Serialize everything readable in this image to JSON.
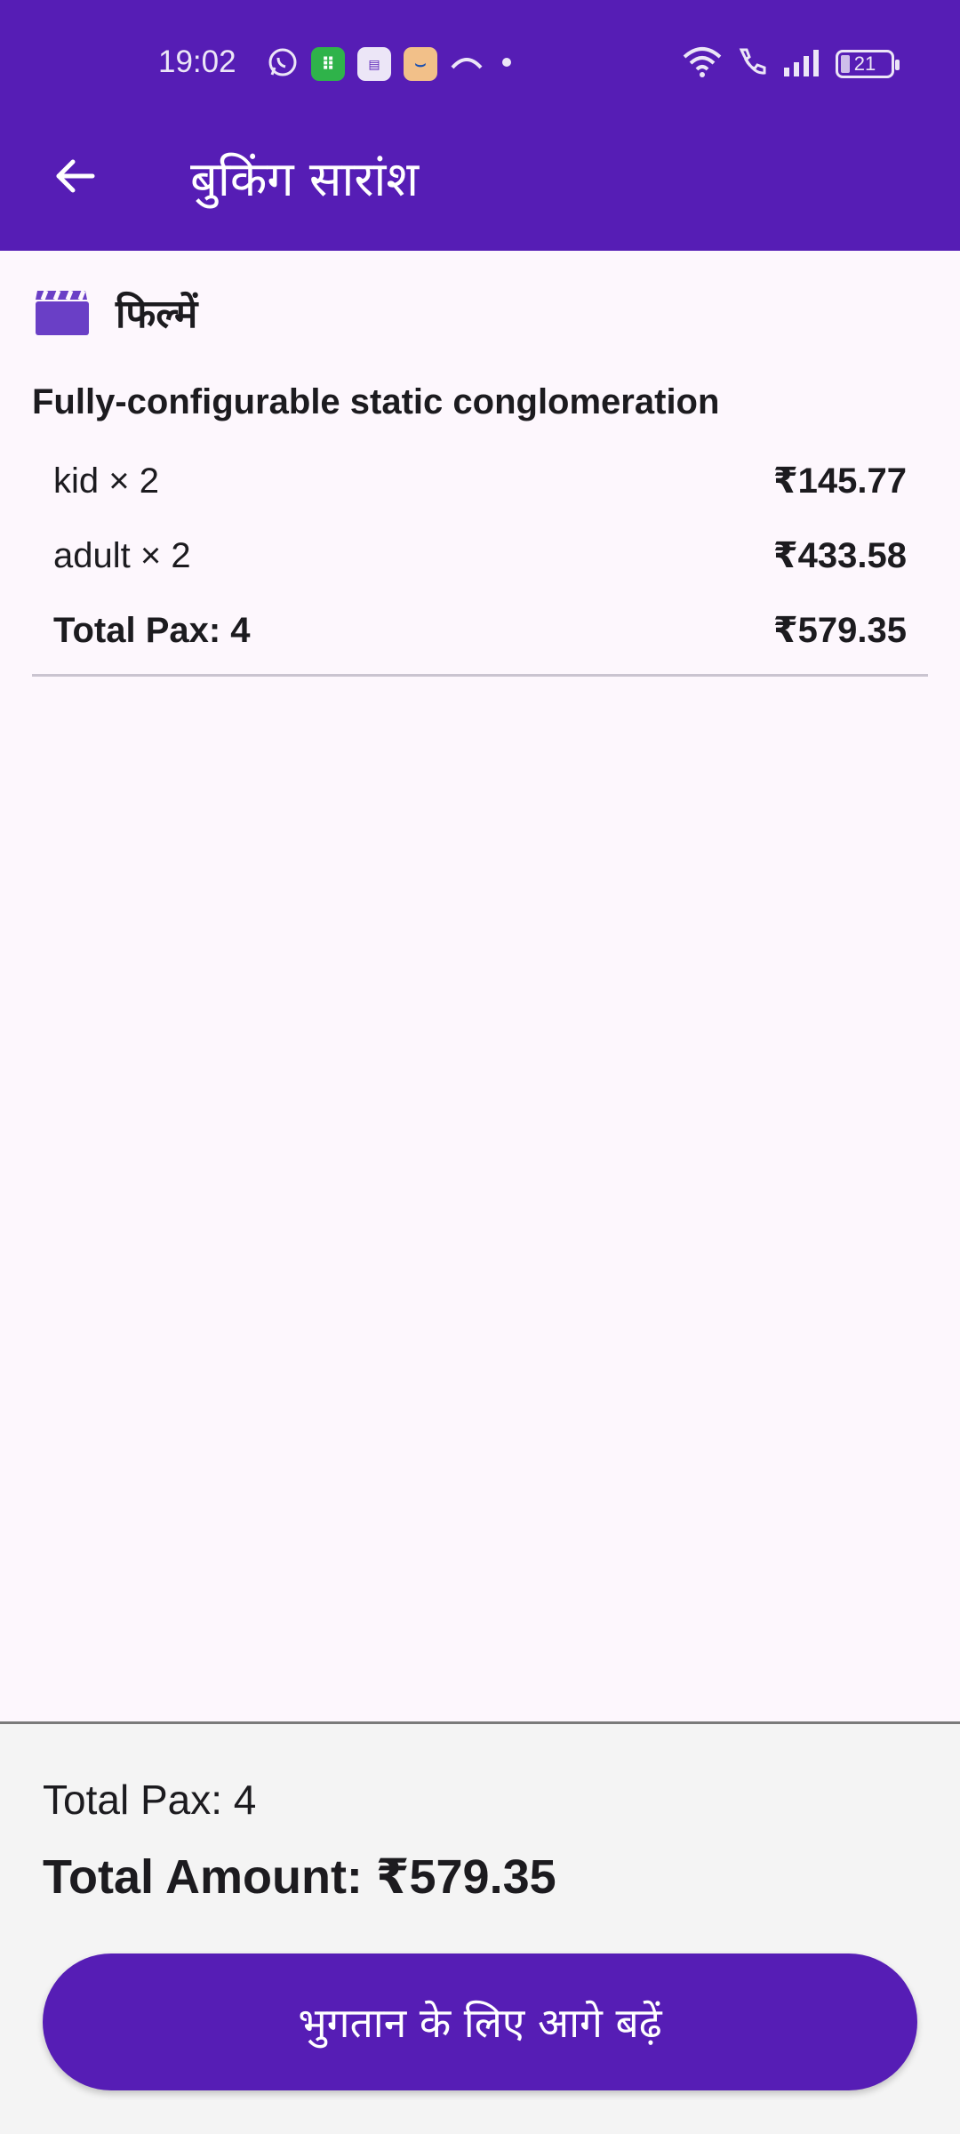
{
  "status_bar": {
    "time": "19:02",
    "battery": "21",
    "left_icons": [
      "whatsapp-icon",
      "app-green-icon",
      "app-khata-icon",
      "amazon-icon",
      "missed-call-icon",
      "dot-icon"
    ],
    "right_icons": [
      "wifi-icon",
      "wifi-call-icon",
      "signal-icon",
      "battery-icon"
    ]
  },
  "app_bar": {
    "title": "बुकिंग सारांश",
    "back_icon": "arrow-back-icon",
    "color": "#561db5"
  },
  "section": {
    "icon": "movie-clapper-icon",
    "title": "फिल्में"
  },
  "item": {
    "title": "Fully-configurable static conglomeration",
    "lines": [
      {
        "label": "kid × 2",
        "price": "₹145.77"
      },
      {
        "label": "adult × 2",
        "price": "₹433.58"
      }
    ],
    "total": {
      "label": "Total Pax: 4",
      "price": "₹579.35"
    }
  },
  "summary": {
    "total_pax": "Total Pax: 4",
    "total_amount": "Total Amount: ₹579.35",
    "pay_button_label": "भुगतान के लिए आगे बढ़ें"
  }
}
